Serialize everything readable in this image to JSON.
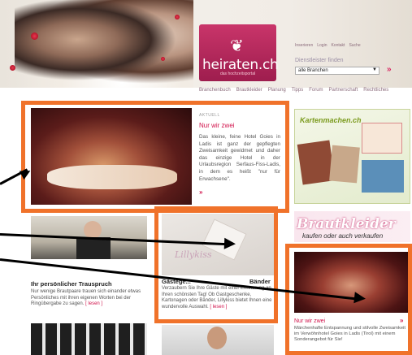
{
  "header": {
    "logo_text": "heiraten.ch",
    "logo_sub": "das hochzeitsportal",
    "toplinks": [
      "Inserieren",
      "Login",
      "Kontakt",
      "Suche"
    ],
    "dienstleister_label": "Dienstleister finden",
    "dienstleister_select": "alle Branchen",
    "go_label": "»"
  },
  "nav": [
    "Branchenbuch",
    "Brautkleider",
    "Planung",
    "Tipps",
    "Forum",
    "Partnerschaft",
    "Rechtliches"
  ],
  "aktuell": {
    "label": "AKTUELL",
    "title": "Nur wir zwei",
    "text": "Das kleine, feine Hotel Goies in Ladis ist ganz der gepflegten Zweisamkeit gewidmet und daher das einzige Hotel in der Urlaubsregion Serfaus-Fiss-Ladis, in dem es heißt \"nur für Erwachsene\".",
    "more": "»"
  },
  "trauspruch": {
    "title": "Ihr persönlicher Trauspruch",
    "text": "Nur wenige Brautpaare trauen sich einander etwas Persönliches mit ihren eigenen Worten bei der Ringübergabe zu sagen.",
    "link": "[ lesen ]"
  },
  "gast": {
    "title": "Gästege...",
    "title_end": "Bänder",
    "text": "Verzaubern Sie Ihre Gäste mit einer Erinnerung an Ihren schönsten Tag! Ob Gastgeschenke, Kartonagen oder Bänder, Lillykiss bietet Ihnen eine wundervolle Auswahl.",
    "link": "[ lesen ]",
    "brand": "Lillykiss"
  },
  "sidebar": {
    "karten_brand": "Kartenmachen.ch",
    "ad_title": "Brautkleider",
    "ad_sub": "kaufen oder auch verkaufen",
    "promo_title": "Nur wir zwei",
    "promo_more": "»",
    "promo_text": "Märchenhafte Entspannung und stilvolle Zweisamkeit im Verwöhnhotel Goies in Ladis (Tirol) mit einem Sonderangebot für Sie!"
  },
  "colors": {
    "accent": "#d0114a",
    "highlight": "#f0722a",
    "logo": "#b22558"
  }
}
